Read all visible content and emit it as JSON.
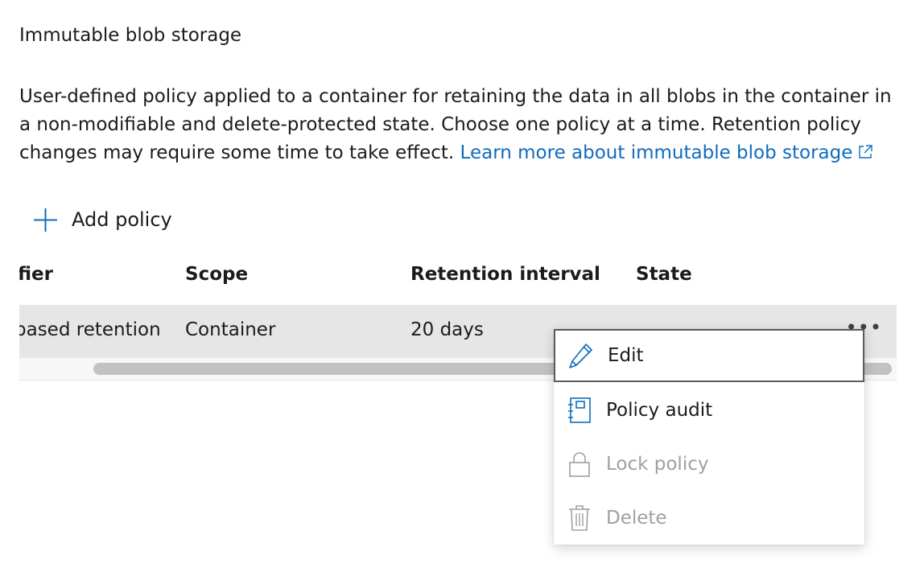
{
  "section": {
    "title": "Immutable blob storage",
    "description": "User-defined policy applied to a container for retaining the data in all blobs in the container in a non-modifiable and delete-protected state. Choose one policy at a time. Retention policy changes may require some time to take effect.",
    "learn_more": "Learn more about immutable blob storage"
  },
  "toolbar": {
    "add_policy": "Add policy"
  },
  "table": {
    "headers": {
      "identifier": "fier",
      "scope": "Scope",
      "retention": "Retention interval",
      "state": "State"
    },
    "row": {
      "identifier": "based retention",
      "scope": "Container",
      "retention": "20 days",
      "more": "•••"
    }
  },
  "context_menu": {
    "items": [
      {
        "label": "Edit",
        "icon": "pencil-icon",
        "enabled": true,
        "focused": true
      },
      {
        "label": "Policy audit",
        "icon": "audit-icon",
        "enabled": true
      },
      {
        "label": "Lock policy",
        "icon": "lock-icon",
        "enabled": false
      },
      {
        "label": "Delete",
        "icon": "trash-icon",
        "enabled": false
      }
    ]
  },
  "colors": {
    "link": "#0f6cbd",
    "icon_blue": "#0f6cbd",
    "disabled": "#a0a0a0",
    "row_selected": "#e6e6e6"
  }
}
